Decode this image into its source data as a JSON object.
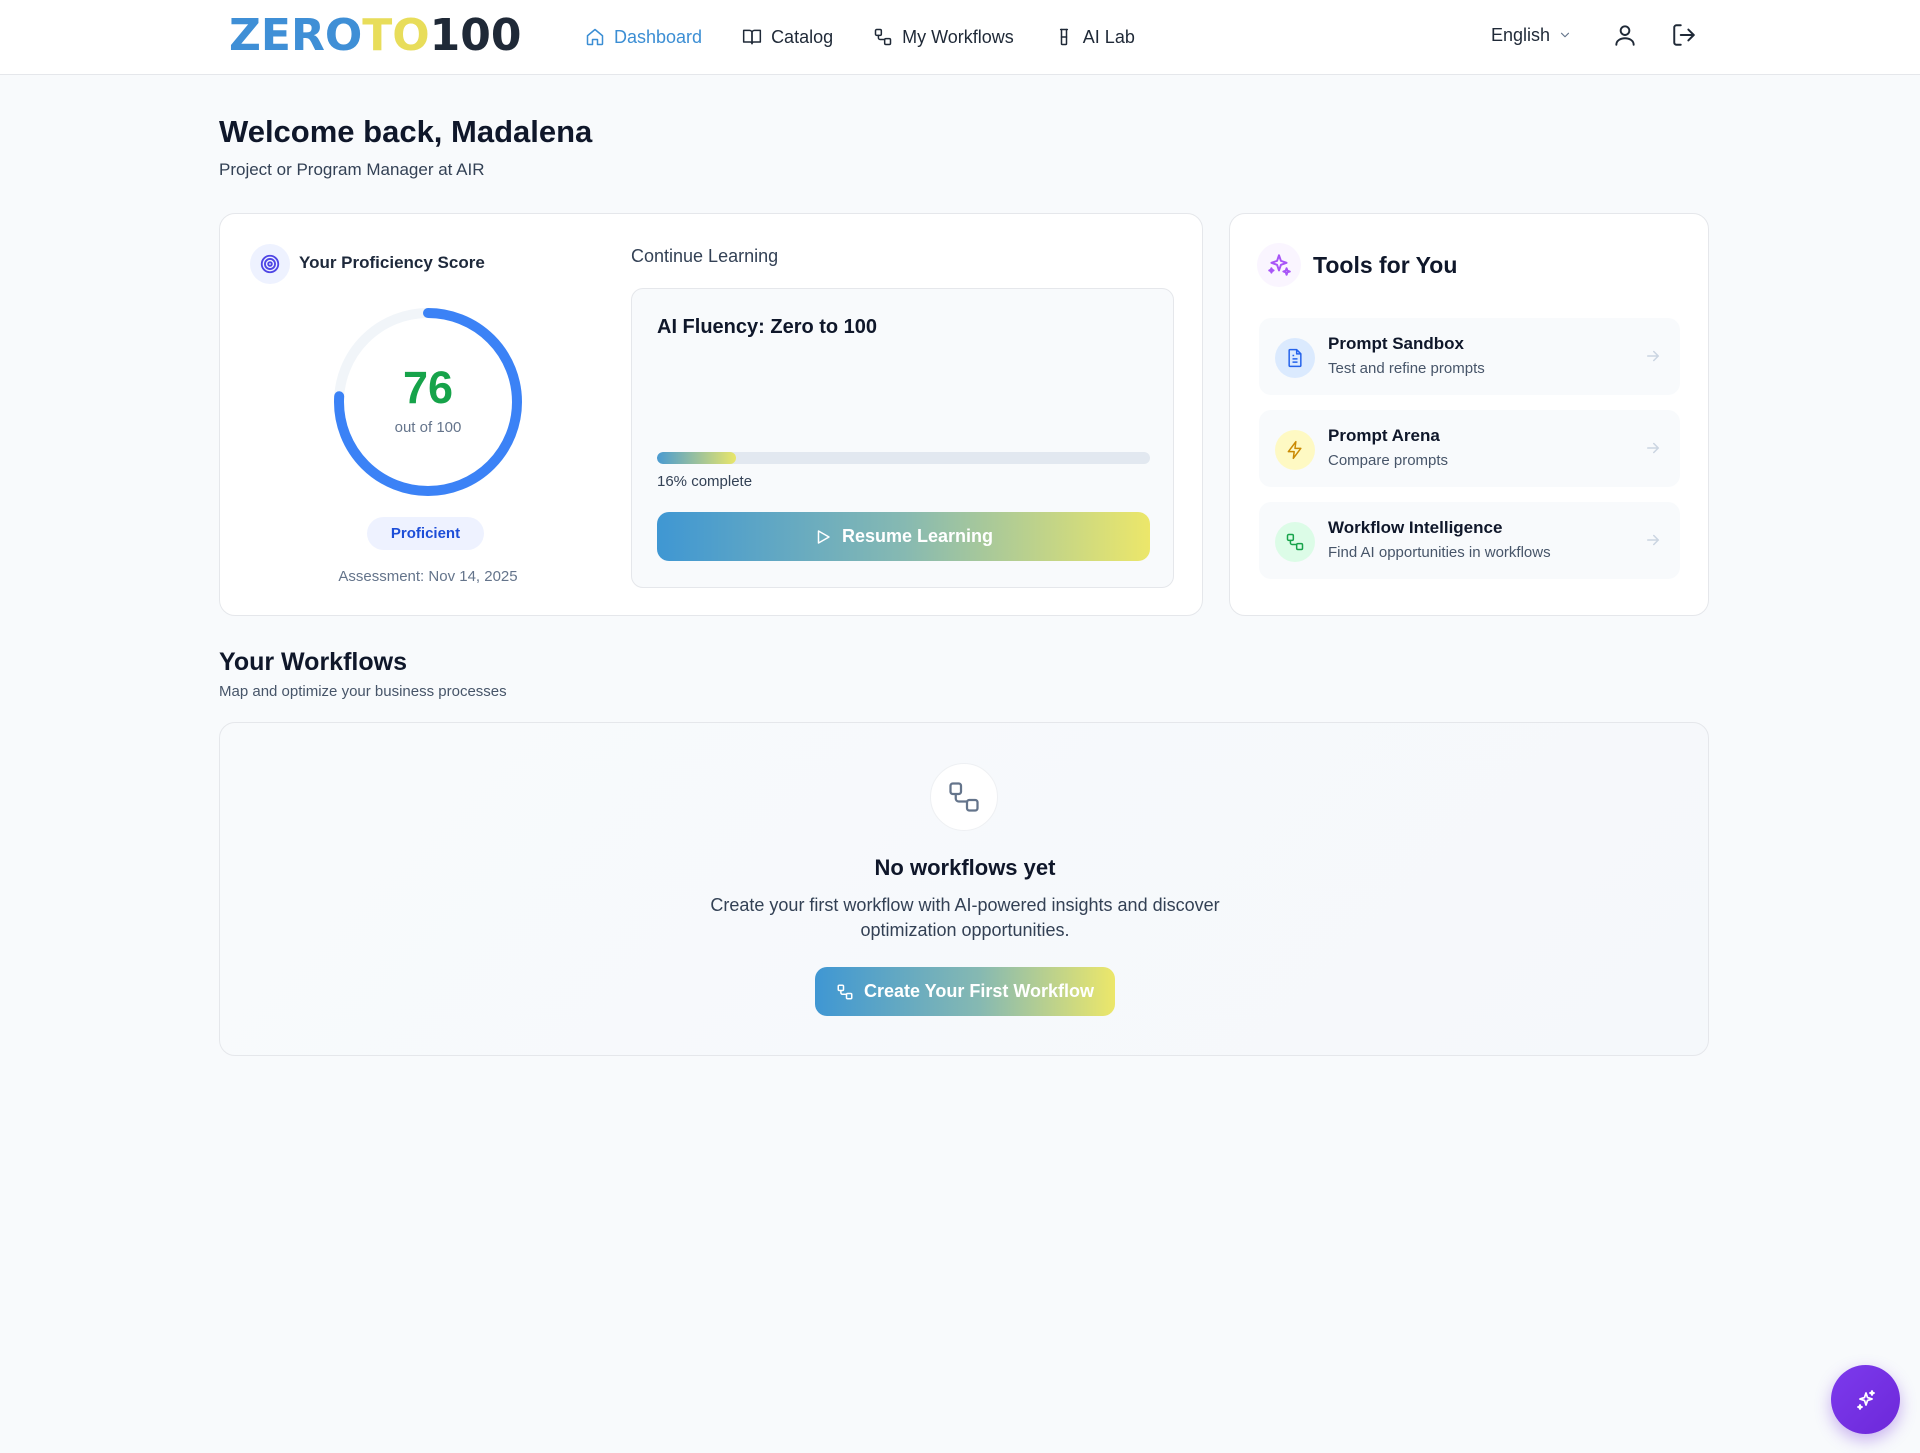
{
  "header": {
    "logo": {
      "part1": "ZERO",
      "part2": "TO",
      "part3": "100"
    },
    "nav": [
      {
        "label": "Dashboard",
        "icon": "home-icon",
        "active": true
      },
      {
        "label": "Catalog",
        "icon": "book-icon"
      },
      {
        "label": "My Workflows",
        "icon": "workflow-icon"
      },
      {
        "label": "AI Lab",
        "icon": "flask-icon"
      }
    ],
    "language": "English",
    "colors": {
      "active": "#3b8ed4",
      "logo_blue": "#3f8fd6",
      "logo_yellow": "#e8dd5a"
    }
  },
  "welcome": {
    "title": "Welcome back, Madalena",
    "subtitle": "Project or Program Manager at AIR"
  },
  "proficiency": {
    "label": "Your Proficiency Score",
    "score": "76",
    "score_value": 76,
    "out_of": "out of 100",
    "level": "Proficient",
    "assessment": "Assessment: Nov 14, 2025",
    "ring_color": "#3b82f6",
    "score_color": "#16a34a"
  },
  "learning": {
    "label": "Continue Learning",
    "course_title": "AI Fluency: Zero to 100",
    "progress_percent": 16,
    "progress_text": "16% complete",
    "button_label": "Resume Learning"
  },
  "tools": {
    "title": "Tools for You",
    "items": [
      {
        "name": "Prompt Sandbox",
        "desc": "Test and refine prompts",
        "icon": "document-icon",
        "icon_bg": "#dbeafe",
        "icon_color": "#2563eb"
      },
      {
        "name": "Prompt Arena",
        "desc": "Compare prompts",
        "icon": "bolt-icon",
        "icon_bg": "#fef9c3",
        "icon_color": "#ca8a04"
      },
      {
        "name": "Workflow Intelligence",
        "desc": "Find AI opportunities in workflows",
        "icon": "workflow-icon",
        "icon_bg": "#dcfce7",
        "icon_color": "#16a34a"
      }
    ]
  },
  "workflows": {
    "title": "Your Workflows",
    "subtitle": "Map and optimize your business processes",
    "empty_title": "No workflows yet",
    "empty_text": "Create your first workflow with AI-powered insights and discover optimization opportunities.",
    "button_label": "Create Your First Workflow"
  }
}
